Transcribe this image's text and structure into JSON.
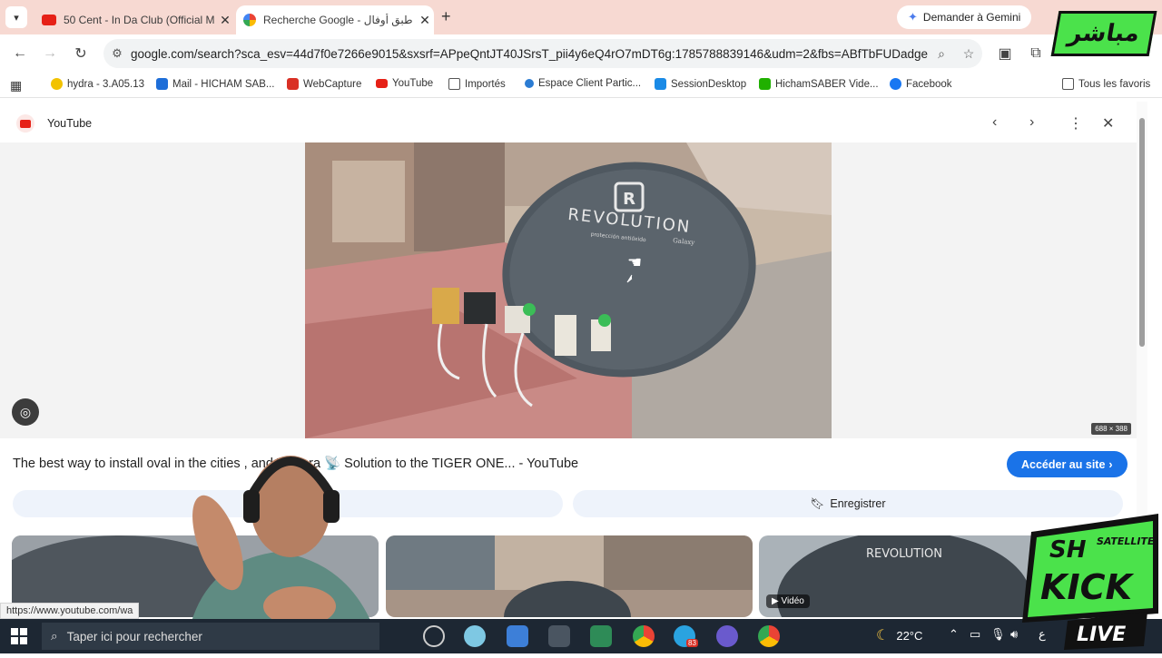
{
  "tabs": [
    {
      "title": "50 Cent - In Da Club (Official M",
      "favicon": "youtube-icon",
      "active": false
    },
    {
      "title": "Recherche Google - طبق أوفال",
      "favicon": "google-icon",
      "active": true
    }
  ],
  "gemini_button": "Demander à Gemini",
  "address_bar": {
    "url": "google.com/search?sca_esv=44d7f0e7266e9015&sxsrf=APpeQntJT40JSrsT_pii4y6eQ4rO7mDT6g:1785788839146&udm=2&fbs=ABfTbFUDadgeu2..."
  },
  "bookmarks": [
    {
      "label": "hydra - 3.A05.13",
      "icon": "bookmark-icon",
      "color": "#f2c200"
    },
    {
      "label": "Mail - HICHAM SAB...",
      "icon": "outlook-icon",
      "color": "#1e6ed8"
    },
    {
      "label": "WebCapture",
      "icon": "webcapture-icon",
      "color": "#d93025"
    },
    {
      "label": "YouTube",
      "icon": "youtube-icon",
      "color": "#e62117"
    },
    {
      "label": "Importés",
      "icon": "folder-icon",
      "color": "#555555"
    },
    {
      "label": "Espace Client Partic...",
      "icon": "bank-icon",
      "color": "#2b7cd3"
    },
    {
      "label": "SessionDesktop",
      "icon": "session-icon",
      "color": "#1a8ae6"
    },
    {
      "label": "HichamSABER Vide...",
      "icon": "kick-icon",
      "color": "#20b000"
    },
    {
      "label": "Facebook",
      "icon": "facebook-icon",
      "color": "#1877f2"
    }
  ],
  "all_favorites": "Tous les favoris",
  "viewer": {
    "source": "YouTube",
    "dimensions": "688 × 388",
    "caption": "The best way to install oval in the cities         , and Temara 📡 Solution to the TIGER ONE... - YouTube",
    "visit_button": "Accéder au site",
    "save_button": "Enregistrer",
    "dish_brand": "REVOLUTION",
    "dish_sub": "protección antióxido",
    "dish_model": "Galaxy",
    "video_badge": "Vidéo"
  },
  "status_url": "https://www.youtube.com/wa",
  "taskbar": {
    "search_placeholder": "Taper ici pour rechercher",
    "temperature": "22°C",
    "badge": "83",
    "lang": "ع"
  },
  "overlay": {
    "live_logo": "مباشر",
    "kick_top": "SH",
    "kick_sub": "SATELLITE",
    "kick_main": "KICK",
    "kick_live": "LIVE"
  }
}
